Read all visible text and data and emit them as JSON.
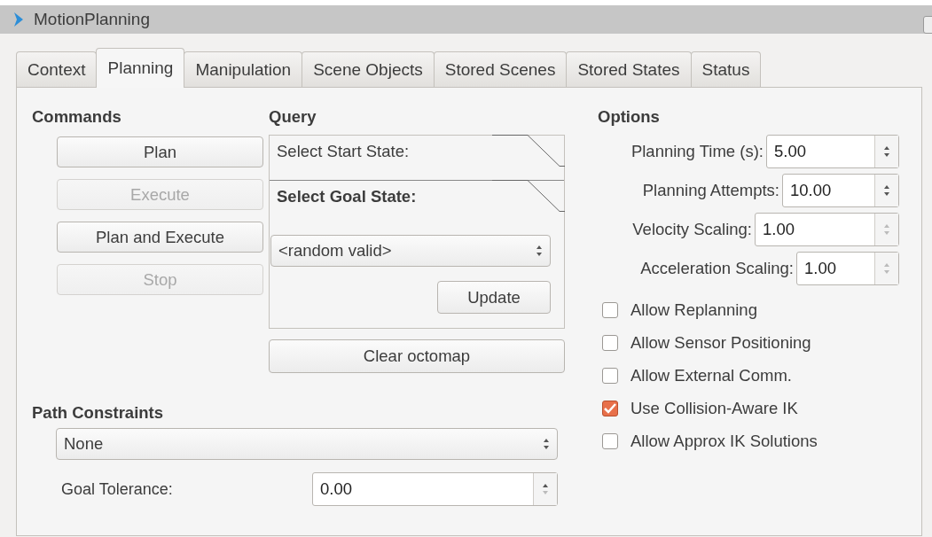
{
  "window": {
    "title": "MotionPlanning"
  },
  "tabs": [
    {
      "label": "Context",
      "selected": false
    },
    {
      "label": "Planning",
      "selected": true
    },
    {
      "label": "Manipulation",
      "selected": false
    },
    {
      "label": "Scene Objects",
      "selected": false
    },
    {
      "label": "Stored Scenes",
      "selected": false
    },
    {
      "label": "Stored States",
      "selected": false
    },
    {
      "label": "Status",
      "selected": false
    }
  ],
  "commands": {
    "title": "Commands",
    "buttons": [
      {
        "label": "Plan",
        "disabled": false
      },
      {
        "label": "Execute",
        "disabled": true
      },
      {
        "label": "Plan and Execute",
        "disabled": false
      },
      {
        "label": "Stop",
        "disabled": true
      }
    ]
  },
  "query": {
    "title": "Query",
    "sections": [
      {
        "label": "Select Start State:",
        "selected": false
      },
      {
        "label": "Select Goal State:",
        "selected": true
      }
    ],
    "state_combo": {
      "value": "<random valid>"
    },
    "update_button": {
      "label": "Update"
    },
    "clear_button": {
      "label": "Clear octomap"
    }
  },
  "options": {
    "title": "Options",
    "spinboxes": [
      {
        "label": "Planning Time (s):",
        "value": "5.00",
        "up_enabled": true,
        "down_enabled": true
      },
      {
        "label": "Planning Attempts:",
        "value": "10.00",
        "up_enabled": true,
        "down_enabled": true
      },
      {
        "label": "Velocity Scaling:",
        "value": "1.00",
        "up_enabled": false,
        "down_enabled": false
      },
      {
        "label": "Acceleration Scaling:",
        "value": "1.00",
        "up_enabled": false,
        "down_enabled": false
      }
    ],
    "checkboxes": [
      {
        "label": "Allow Replanning",
        "checked": false
      },
      {
        "label": "Allow Sensor Positioning",
        "checked": false
      },
      {
        "label": "Allow External Comm.",
        "checked": false
      },
      {
        "label": "Use Collision-Aware IK",
        "checked": true
      },
      {
        "label": "Allow Approx IK Solutions",
        "checked": false
      }
    ]
  },
  "path_constraints": {
    "title": "Path Constraints",
    "combo_value": "None",
    "tolerance": {
      "label": "Goal Tolerance:",
      "value": "0.00",
      "up_enabled": true,
      "down_enabled": false
    }
  }
}
